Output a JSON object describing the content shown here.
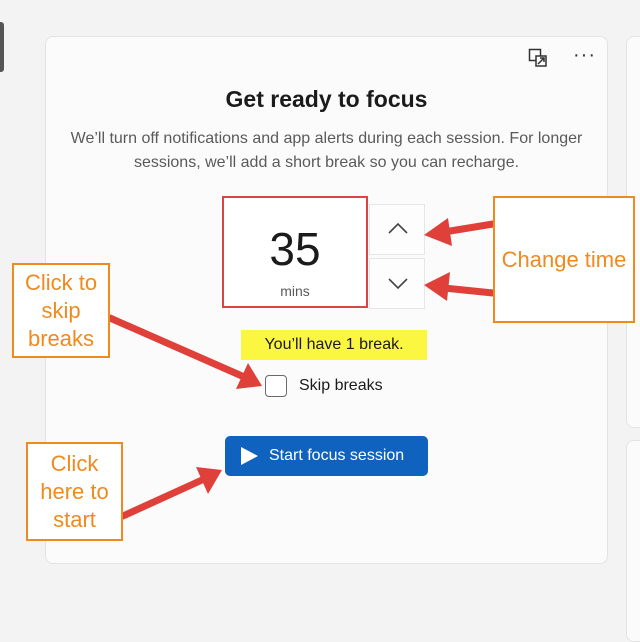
{
  "focus": {
    "title": "Get ready to focus",
    "description": "We’ll turn off notifications and app alerts during each session. For longer sessions, we’ll add a short break so you can recharge.",
    "time_value": "35",
    "time_unit": "mins",
    "break_note": "You’ll have 1 break.",
    "skip_label": "Skip breaks",
    "skip_checked": false,
    "start_label": "Start focus session"
  },
  "icons": {
    "compact": "compact-overlay-icon",
    "more": "more-options-icon",
    "up": "chevron-up-icon",
    "down": "chevron-down-icon",
    "play": "play-icon"
  },
  "annotations": {
    "change_time": "Change time",
    "skip_breaks": "Click to skip breaks",
    "start": "Click here to start"
  },
  "colors": {
    "accent": "#0f63bf",
    "highlight": "#fbf63f",
    "annotation": "#ef8a1e",
    "arrow": "#e0403a",
    "time_border": "#d94545"
  }
}
